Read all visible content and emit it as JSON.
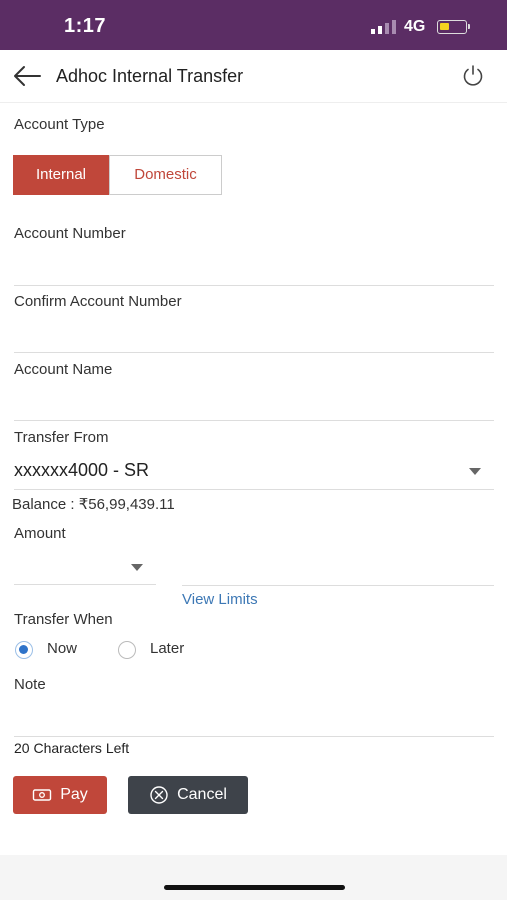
{
  "status_bar": {
    "time": "1:17",
    "network": "4G"
  },
  "header": {
    "title": "Adhoc Internal Transfer"
  },
  "account_type": {
    "label": "Account Type",
    "options": [
      "Internal",
      "Domestic"
    ],
    "selected": "Internal"
  },
  "account_number": {
    "label": "Account Number",
    "value": ""
  },
  "confirm_account_number": {
    "label": "Confirm Account Number",
    "value": ""
  },
  "account_name": {
    "label": "Account Name",
    "value": ""
  },
  "transfer_from": {
    "label": "Transfer From",
    "value": "xxxxxx4000 - SR",
    "balance_text": "Balance : ₹56,99,439.11"
  },
  "amount": {
    "label": "Amount",
    "currency_value": "",
    "value": "",
    "view_limits": "View Limits"
  },
  "transfer_when": {
    "label": "Transfer When",
    "options": [
      "Now",
      "Later"
    ],
    "selected": "Now"
  },
  "note": {
    "label": "Note",
    "value": "",
    "chars_left": "20 Characters Left"
  },
  "actions": {
    "pay": "Pay",
    "cancel": "Cancel"
  },
  "colors": {
    "status_bar": "#5b2d64",
    "accent": "#c0473a",
    "link": "#3d78b5",
    "cancel_bg": "#3e434a"
  }
}
